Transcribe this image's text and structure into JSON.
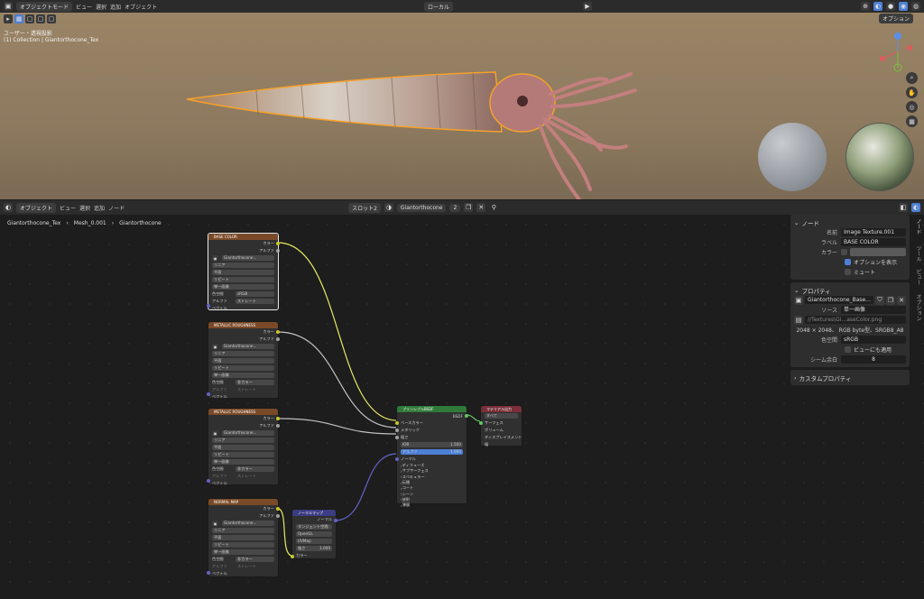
{
  "top_header": {
    "mode": "オブジェクトモード",
    "menus": [
      "ビュー",
      "選択",
      "追加",
      "オブジェクト"
    ],
    "transform": "ローカル",
    "options": "オプション"
  },
  "viewport": {
    "view_name": "ユーザー・透視投影",
    "collection": "(1) Collection | Giantorthocone_Tex"
  },
  "node_header": {
    "mode": "オブジェクト",
    "menus": [
      "ビュー",
      "選択",
      "追加",
      "ノード"
    ],
    "slot": "スロット2",
    "material": "Giantorthocone",
    "users": "2"
  },
  "breadcrumb": [
    "Giantorthocone_Tex",
    "Mesh_0.001",
    "Giantorthocone"
  ],
  "tex_nodes": [
    {
      "title": "BASE COLOR",
      "image": "Giantorthocone...",
      "interp": "リニア",
      "proj": "平面",
      "ext": "リピート",
      "src": "単一画像",
      "cs_label": "色空間",
      "cs": "sRGB",
      "alpha_label": "アルファ",
      "alpha": "ストレート",
      "out_color": "カラー",
      "out_alpha": "アルファ",
      "in_vec": "ベクトル"
    },
    {
      "title": "METALLIC ROUGHNESS",
      "image": "Giantorthocone...",
      "interp": "リニア",
      "proj": "平面",
      "ext": "リピート",
      "src": "単一画像",
      "cs_label": "色空間",
      "cs": "非カラー",
      "alpha_label": "アルファ",
      "alpha": "ストレート",
      "out_color": "カラー",
      "out_alpha": "アルファ",
      "in_vec": "ベクトル"
    },
    {
      "title": "METALLIC ROUGHNESS",
      "image": "Giantorthocone...",
      "interp": "リニア",
      "proj": "平面",
      "ext": "リピート",
      "src": "単一画像",
      "cs_label": "色空間",
      "cs": "非カラー",
      "alpha_label": "アルファ",
      "alpha": "ストレート",
      "out_color": "カラー",
      "out_alpha": "アルファ",
      "in_vec": "ベクトル"
    },
    {
      "title": "NORMAL MAP",
      "image": "Giantorthocone...",
      "interp": "リニア",
      "proj": "平面",
      "ext": "リピート",
      "src": "単一画像",
      "cs_label": "色空間",
      "cs": "非カラー",
      "alpha_label": "アルファ",
      "alpha": "ストレート",
      "out_color": "カラー",
      "out_alpha": "アルファ",
      "in_vec": "ベクトル"
    }
  ],
  "normal_node": {
    "title": "ノーマルマップ",
    "out": "ノーマル",
    "space": "タンジェント空間",
    "gl": "OpenGL",
    "uv": "UVMap",
    "strength_label": "強さ",
    "strength": "1.000",
    "in_color": "カラー"
  },
  "bsdf": {
    "title": "プリンシプルBSDF",
    "out": "BSDF",
    "inputs": [
      "ベースカラー",
      "メタリック",
      "粗さ"
    ],
    "ior_label": "IOR",
    "ior": "1.500",
    "alpha_label": "アルファ",
    "alpha": "1.000",
    "normal": "ノーマル",
    "panels": [
      "ディフューズ",
      "サブサーフェス",
      "スペキュラー",
      "伝播",
      "コート",
      "シーン",
      "放射",
      "薄膜"
    ]
  },
  "mat_out": {
    "title": "マテリアル出力",
    "target": "すべて",
    "inputs": [
      "サーフェス",
      "ボリューム",
      "ディスプレイスメント",
      "幅"
    ]
  },
  "npanel": {
    "node_section": "ノード",
    "name_label": "名前",
    "name": "Image Texture.001",
    "label_label": "ラベル",
    "label": "BASE COLOR",
    "color_label": "カラー",
    "show_options": "オプションを表示",
    "mute": "ミュート",
    "props_section": "プロパティ",
    "image": "Giantorthocone_Base...",
    "source_label": "ソース",
    "source": "単一画像",
    "path": "//Textures\\Gi...aseColor.png",
    "info": "2048 × 2048、 RGB byte型、SRGB8_A8",
    "cs_label": "色空間",
    "cs": "sRGB",
    "view_also": "ビューにも適用",
    "seam_label": "シーム余白",
    "seam": "8",
    "custom": "カスタムプロパティ"
  },
  "side_tabs": [
    "ノード",
    "ツール",
    "ビュー",
    "オプション"
  ]
}
